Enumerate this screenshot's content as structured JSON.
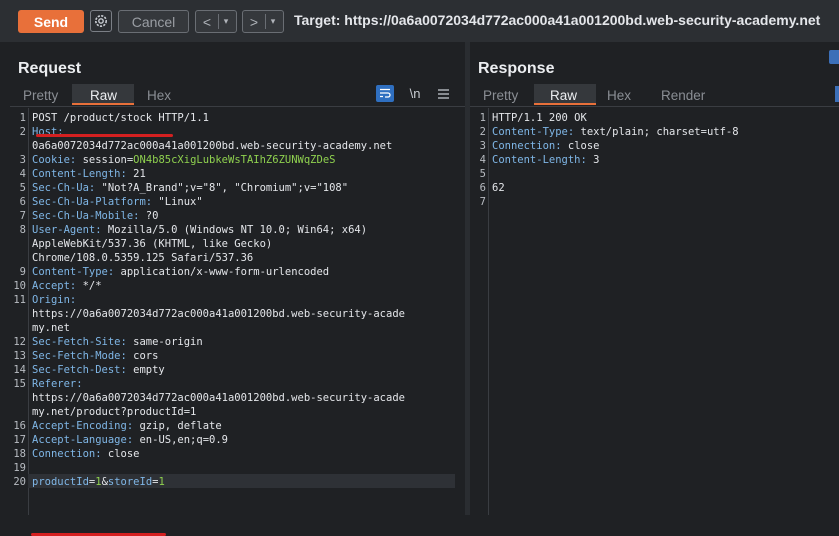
{
  "toolbar": {
    "send_label": "Send",
    "cancel_label": "Cancel",
    "back_arrow": "<",
    "forward_arrow": ">",
    "dropdown_glyph": "▾",
    "target_text": "Target: https://0a6a0072034d772ac000a41a001200bd.web-security-academy.net"
  },
  "request": {
    "title": "Request",
    "tabs": [
      "Pretty",
      "Raw",
      "Hex"
    ],
    "active_tab": "Raw",
    "newline_toggle": "\\n",
    "lines": [
      {
        "n": "1",
        "parts": [
          {
            "t": "POST /product/stock HTTP/1.1",
            "c": ""
          }
        ]
      },
      {
        "n": "2",
        "parts": [
          {
            "t": "Host:",
            "c": "hname"
          }
        ]
      },
      {
        "n": "",
        "parts": [
          {
            "t": "0a6a0072034d772ac000a41a001200bd.web-security-academy.net",
            "c": ""
          }
        ]
      },
      {
        "n": "3",
        "parts": [
          {
            "t": "Cookie:",
            "c": "hname"
          },
          {
            "t": " session=",
            "c": ""
          },
          {
            "t": "ON4b85cXigLubkeWsTAIhZ6ZUNWqZDeS",
            "c": "cookie"
          }
        ]
      },
      {
        "n": "4",
        "parts": [
          {
            "t": "Content-Length:",
            "c": "hname"
          },
          {
            "t": " 21",
            "c": ""
          }
        ]
      },
      {
        "n": "5",
        "parts": [
          {
            "t": "Sec-Ch-Ua:",
            "c": "hname"
          },
          {
            "t": " \"Not?A_Brand\";v=\"8\", \"Chromium\";v=\"108\"",
            "c": ""
          }
        ]
      },
      {
        "n": "6",
        "parts": [
          {
            "t": "Sec-Ch-Ua-Platform:",
            "c": "hname"
          },
          {
            "t": " \"Linux\"",
            "c": ""
          }
        ]
      },
      {
        "n": "7",
        "parts": [
          {
            "t": "Sec-Ch-Ua-Mobile:",
            "c": "hname"
          },
          {
            "t": " ?0",
            "c": ""
          }
        ]
      },
      {
        "n": "8",
        "parts": [
          {
            "t": "User-Agent:",
            "c": "hname"
          },
          {
            "t": " Mozilla/5.0 (Windows NT 10.0; Win64; x64)",
            "c": ""
          }
        ]
      },
      {
        "n": "",
        "parts": [
          {
            "t": "AppleWebKit/537.36 (KHTML, like Gecko)",
            "c": ""
          }
        ]
      },
      {
        "n": "",
        "parts": [
          {
            "t": "Chrome/108.0.5359.125 Safari/537.36",
            "c": ""
          }
        ]
      },
      {
        "n": "9",
        "parts": [
          {
            "t": "Content-Type:",
            "c": "hname"
          },
          {
            "t": " application/x-www-form-urlencoded",
            "c": ""
          }
        ]
      },
      {
        "n": "10",
        "parts": [
          {
            "t": "Accept:",
            "c": "hname"
          },
          {
            "t": " */*",
            "c": ""
          }
        ]
      },
      {
        "n": "11",
        "parts": [
          {
            "t": "Origin:",
            "c": "hname"
          }
        ]
      },
      {
        "n": "",
        "parts": [
          {
            "t": "https://0a6a0072034d772ac000a41a001200bd.web-security-acade",
            "c": ""
          }
        ]
      },
      {
        "n": "",
        "parts": [
          {
            "t": "my.net",
            "c": ""
          }
        ]
      },
      {
        "n": "12",
        "parts": [
          {
            "t": "Sec-Fetch-Site:",
            "c": "hname"
          },
          {
            "t": " same-origin",
            "c": ""
          }
        ]
      },
      {
        "n": "13",
        "parts": [
          {
            "t": "Sec-Fetch-Mode:",
            "c": "hname"
          },
          {
            "t": " cors",
            "c": ""
          }
        ]
      },
      {
        "n": "14",
        "parts": [
          {
            "t": "Sec-Fetch-Dest:",
            "c": "hname"
          },
          {
            "t": " empty",
            "c": ""
          }
        ]
      },
      {
        "n": "15",
        "parts": [
          {
            "t": "Referer:",
            "c": "hname"
          }
        ]
      },
      {
        "n": "",
        "parts": [
          {
            "t": "https://0a6a0072034d772ac000a41a001200bd.web-security-acade",
            "c": ""
          }
        ]
      },
      {
        "n": "",
        "parts": [
          {
            "t": "my.net/product?productId=1",
            "c": ""
          }
        ]
      },
      {
        "n": "16",
        "parts": [
          {
            "t": "Accept-Encoding:",
            "c": "hname"
          },
          {
            "t": " gzip, deflate",
            "c": ""
          }
        ]
      },
      {
        "n": "17",
        "parts": [
          {
            "t": "Accept-Language:",
            "c": "hname"
          },
          {
            "t": " en-US,en;q=0.9",
            "c": ""
          }
        ]
      },
      {
        "n": "18",
        "parts": [
          {
            "t": "Connection:",
            "c": "hname"
          },
          {
            "t": " close",
            "c": ""
          }
        ]
      },
      {
        "n": "19",
        "parts": []
      },
      {
        "n": "20",
        "parts": [
          {
            "t": "productId",
            "c": "param"
          },
          {
            "t": "=",
            "c": "amp"
          },
          {
            "t": "1",
            "c": "pval"
          },
          {
            "t": "&",
            "c": "amp"
          },
          {
            "t": "storeId",
            "c": "param"
          },
          {
            "t": "=",
            "c": "amp"
          },
          {
            "t": "1",
            "c": "pval"
          }
        ]
      }
    ]
  },
  "response": {
    "title": "Response",
    "tabs": [
      "Pretty",
      "Raw",
      "Hex",
      "Render"
    ],
    "active_tab": "Raw",
    "lines": [
      {
        "n": "1",
        "parts": [
          {
            "t": "HTTP/1.1 200 OK",
            "c": ""
          }
        ]
      },
      {
        "n": "2",
        "parts": [
          {
            "t": "Content-Type:",
            "c": "hname"
          },
          {
            "t": " text/plain; charset=utf-8",
            "c": ""
          }
        ]
      },
      {
        "n": "3",
        "parts": [
          {
            "t": "Connection:",
            "c": "hname"
          },
          {
            "t": " close",
            "c": ""
          }
        ]
      },
      {
        "n": "4",
        "parts": [
          {
            "t": "Content-Length:",
            "c": "hname"
          },
          {
            "t": " 3",
            "c": ""
          }
        ]
      },
      {
        "n": "5",
        "parts": []
      },
      {
        "n": "6",
        "parts": [
          {
            "t": "62",
            "c": ""
          }
        ]
      },
      {
        "n": "7",
        "parts": []
      }
    ]
  },
  "colors": {
    "send": "#e8703a",
    "header_name": "#7fb6e6",
    "value_green": "#8fd14f",
    "annotation_red": "#d42020"
  }
}
